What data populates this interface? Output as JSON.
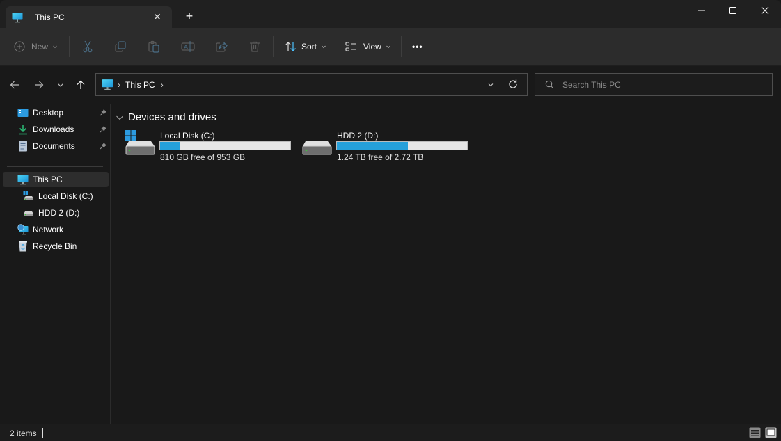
{
  "window": {
    "tab_title": "This PC",
    "tab_icon": "this-pc-icon",
    "close_tab_symbol": "✕",
    "new_tab_symbol": "+"
  },
  "toolbar": {
    "new_label": "New",
    "sort_label": "Sort",
    "view_label": "View",
    "more_label": "•••",
    "actions": [
      "cut",
      "copy",
      "paste",
      "rename",
      "share",
      "delete"
    ]
  },
  "address": {
    "crumbs": [
      "This PC"
    ],
    "separator": "›"
  },
  "search": {
    "placeholder": "Search This PC",
    "value": ""
  },
  "sidebar": {
    "pinned": [
      {
        "label": "Desktop",
        "icon": "desktop-icon"
      },
      {
        "label": "Downloads",
        "icon": "downloads-icon"
      },
      {
        "label": "Documents",
        "icon": "documents-icon"
      }
    ],
    "tree": [
      {
        "label": "This PC",
        "icon": "this-pc-icon",
        "selected": true
      },
      {
        "label": "Local Disk (C:)",
        "icon": "windows-drive-icon"
      },
      {
        "label": "HDD 2 (D:)",
        "icon": "drive-icon"
      },
      {
        "label": "Network",
        "icon": "network-icon"
      },
      {
        "label": "Recycle Bin",
        "icon": "recycle-bin-icon"
      }
    ]
  },
  "content": {
    "group_title": "Devices and drives",
    "drives": [
      {
        "name": "Local Disk (C:)",
        "free_text": "810 GB free of 953 GB",
        "used_fraction": 0.15,
        "accent": "#26a0da"
      },
      {
        "name": "HDD 2 (D:)",
        "free_text": "1.24 TB free of 2.72 TB",
        "used_fraction": 0.544,
        "accent": "#26a0da"
      }
    ]
  },
  "status": {
    "item_count": "2 items"
  }
}
